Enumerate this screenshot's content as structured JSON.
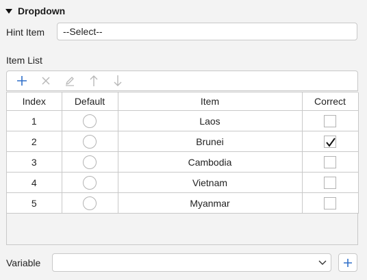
{
  "section": {
    "title": "Dropdown",
    "collapse_icon": "caret-down-icon"
  },
  "hint": {
    "label": "Hint Item",
    "value": "--Select--"
  },
  "item_list": {
    "label": "Item List",
    "toolbar": [
      {
        "icon": "plus-icon",
        "enabled": true
      },
      {
        "icon": "close-icon",
        "enabled": false
      },
      {
        "icon": "pencil-icon",
        "enabled": false
      },
      {
        "icon": "arrow-up-icon",
        "enabled": false
      },
      {
        "icon": "arrow-down-icon",
        "enabled": false
      }
    ],
    "columns": [
      "Index",
      "Default",
      "Item",
      "Correct"
    ],
    "rows": [
      {
        "index": "1",
        "default": false,
        "item": "Laos",
        "correct": false
      },
      {
        "index": "2",
        "default": false,
        "item": "Brunei",
        "correct": true
      },
      {
        "index": "3",
        "default": false,
        "item": "Cambodia",
        "correct": false
      },
      {
        "index": "4",
        "default": false,
        "item": "Vietnam",
        "correct": false
      },
      {
        "index": "5",
        "default": false,
        "item": "Myanmar",
        "correct": false
      }
    ]
  },
  "variable": {
    "label": "Variable",
    "value": "",
    "dropdown_icon": "chevron-down-icon",
    "add_icon": "plus-icon"
  },
  "colors": {
    "accent": "#2f6fc9",
    "disabled_icon": "#b8b8b8",
    "border": "#c8c8c8",
    "background": "#f3f3f3"
  }
}
